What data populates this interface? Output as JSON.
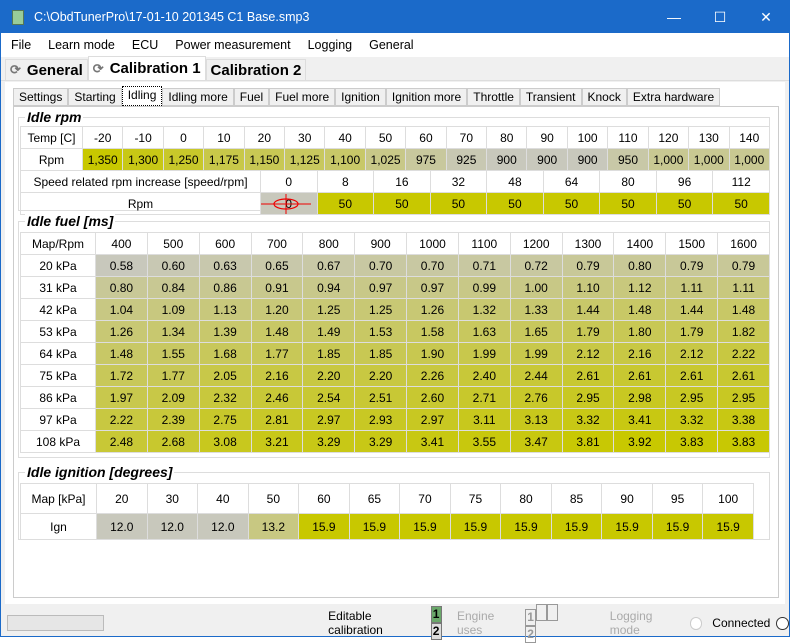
{
  "window": {
    "title": "C:\\ObdTunerPro\\17-01-10 201345 C1 Base.smp3"
  },
  "menu": [
    "File",
    "Learn mode",
    "ECU",
    "Power measurement",
    "Logging",
    "General"
  ],
  "main_tabs": [
    "General",
    "Calibration 1",
    "Calibration 2"
  ],
  "sub_tabs": [
    "Settings",
    "Starting",
    "Idling",
    "Idling more",
    "Fuel",
    "Fuel more",
    "Ignition",
    "Ignition more",
    "Throttle",
    "Transient",
    "Knock",
    "Extra hardware"
  ],
  "idle_rpm": {
    "title": "Idle rpm",
    "header_label": "Temp [C]",
    "row_label": "Rpm",
    "temps": [
      "-20",
      "-10",
      "0",
      "10",
      "20",
      "30",
      "40",
      "50",
      "60",
      "70",
      "80",
      "90",
      "100",
      "110",
      "120",
      "130",
      "140"
    ],
    "values": [
      "1,350",
      "1,300",
      "1,250",
      "1,175",
      "1,150",
      "1,125",
      "1,100",
      "1,025",
      "975",
      "925",
      "900",
      "900",
      "900",
      "950",
      "1,000",
      "1,000",
      "1,000"
    ]
  },
  "speed_rpm": {
    "header_label": "Speed related rpm increase [speed/rpm]",
    "row_label": "Rpm",
    "speeds": [
      "0",
      "8",
      "16",
      "32",
      "48",
      "64",
      "80",
      "96",
      "112"
    ],
    "values": [
      "0",
      "50",
      "50",
      "50",
      "50",
      "50",
      "50",
      "50",
      "50"
    ]
  },
  "idle_fuel": {
    "title": "Idle fuel [ms]",
    "corner": "Map/Rpm",
    "rpms": [
      "400",
      "500",
      "600",
      "700",
      "800",
      "900",
      "1000",
      "1100",
      "1200",
      "1300",
      "1400",
      "1500",
      "1600"
    ],
    "rows": [
      {
        "label": "20 kPa",
        "values": [
          "0.58",
          "0.60",
          "0.63",
          "0.65",
          "0.67",
          "0.70",
          "0.70",
          "0.71",
          "0.72",
          "0.79",
          "0.80",
          "0.79",
          "0.79"
        ]
      },
      {
        "label": "31 kPa",
        "values": [
          "0.80",
          "0.84",
          "0.86",
          "0.91",
          "0.94",
          "0.97",
          "0.97",
          "0.99",
          "1.00",
          "1.10",
          "1.12",
          "1.11",
          "1.11"
        ]
      },
      {
        "label": "42 kPa",
        "values": [
          "1.04",
          "1.09",
          "1.13",
          "1.20",
          "1.25",
          "1.25",
          "1.26",
          "1.32",
          "1.33",
          "1.44",
          "1.48",
          "1.44",
          "1.48"
        ]
      },
      {
        "label": "53 kPa",
        "values": [
          "1.26",
          "1.34",
          "1.39",
          "1.48",
          "1.49",
          "1.53",
          "1.58",
          "1.63",
          "1.65",
          "1.79",
          "1.80",
          "1.79",
          "1.82"
        ]
      },
      {
        "label": "64 kPa",
        "values": [
          "1.48",
          "1.55",
          "1.68",
          "1.77",
          "1.85",
          "1.85",
          "1.90",
          "1.99",
          "1.99",
          "2.12",
          "2.16",
          "2.12",
          "2.22"
        ]
      },
      {
        "label": "75 kPa",
        "values": [
          "1.72",
          "1.77",
          "2.05",
          "2.16",
          "2.20",
          "2.20",
          "2.26",
          "2.40",
          "2.44",
          "2.61",
          "2.61",
          "2.61",
          "2.61"
        ]
      },
      {
        "label": "86 kPa",
        "values": [
          "1.97",
          "2.09",
          "2.32",
          "2.46",
          "2.54",
          "2.51",
          "2.60",
          "2.71",
          "2.76",
          "2.95",
          "2.98",
          "2.95",
          "2.95"
        ]
      },
      {
        "label": "97 kPa",
        "values": [
          "2.22",
          "2.39",
          "2.75",
          "2.81",
          "2.97",
          "2.93",
          "2.97",
          "3.11",
          "3.13",
          "3.32",
          "3.41",
          "3.32",
          "3.38"
        ]
      },
      {
        "label": "108 kPa",
        "values": [
          "2.48",
          "2.68",
          "3.08",
          "3.21",
          "3.29",
          "3.29",
          "3.41",
          "3.55",
          "3.47",
          "3.81",
          "3.92",
          "3.83",
          "3.83"
        ]
      }
    ]
  },
  "idle_ignition": {
    "title": "Idle ignition [degrees]",
    "header_label": "Map [kPa]",
    "row_label": "Ign",
    "maps": [
      "20",
      "30",
      "40",
      "50",
      "60",
      "65",
      "70",
      "75",
      "80",
      "85",
      "90",
      "95",
      "100"
    ],
    "values": [
      "12.0",
      "12.0",
      "12.0",
      "13.2",
      "15.9",
      "15.9",
      "15.9",
      "15.9",
      "15.9",
      "15.9",
      "15.9",
      "15.9",
      "15.9"
    ]
  },
  "status": {
    "editable_label": "Editable calibration",
    "editable": [
      "1",
      "2"
    ],
    "engine_label": "Engine uses",
    "engine": [
      "1",
      "",
      "",
      "2"
    ],
    "logging_label": "Logging mode",
    "connected_label": "Connected"
  },
  "colors": {
    "low": "#c8c8bc",
    "high": "#c8c800",
    "title_bar": "#1b6ac9",
    "active_cal": "#6aa86a"
  }
}
